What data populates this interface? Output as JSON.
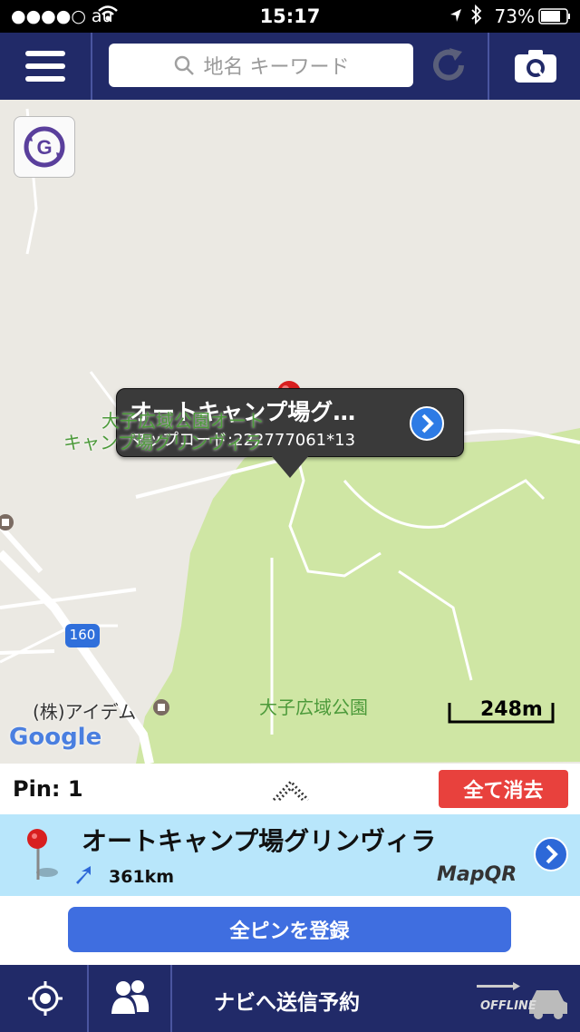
{
  "status_bar": {
    "carrier": "●●●●○ au",
    "time": "15:17",
    "battery": "73%"
  },
  "search": {
    "placeholder": "地名 キーワード"
  },
  "map": {
    "callout": {
      "title": "オートキャンプ場グ…",
      "mapcode": "マップコード:222777061*13"
    },
    "poi_name_line1": "大子広域公園オート",
    "poi_name_line2": "キャンプ場グリンヴィラ",
    "park_label": "大子広域公園",
    "company_label": "(株)アイデム",
    "road_number": "160",
    "scale": "248m",
    "google_logo": "Google"
  },
  "pin_bar": {
    "count_label": "Pin: 1",
    "clear_button": "全て消去"
  },
  "result": {
    "name": "オートキャンプ場グリンヴィラ",
    "distance": "361km",
    "brand": "MapQR"
  },
  "register_button": "全ピンを登録",
  "bottom_bar": {
    "navi_label": "ナビへ送信予約",
    "offline_label": "OFFLINE"
  },
  "colors": {
    "header": "#212a68",
    "accent_blue": "#3f6ee0",
    "clear_red": "#e8413d",
    "result_bg": "#b8e6fb",
    "park_green": "#cfe6a4"
  }
}
